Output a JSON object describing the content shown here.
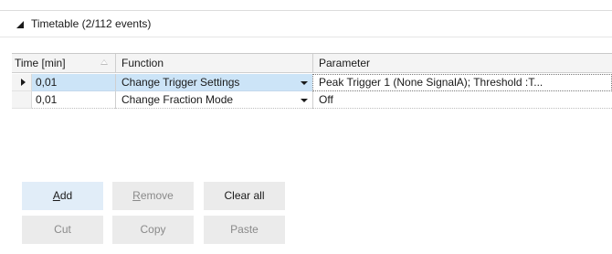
{
  "section": {
    "title": "Timetable (2/112 events)",
    "expanded": true
  },
  "table": {
    "columns": [
      "Time [min]",
      "Function",
      "Parameter"
    ],
    "sort_column": "Time [min]",
    "rows": [
      {
        "time": "0,01",
        "function": "Change Trigger Settings",
        "parameter": "Peak Trigger 1 (None SignalA); Threshold :T...",
        "current": true,
        "selected": true
      },
      {
        "time": "0,01",
        "function": "Change Fraction Mode",
        "parameter": "Off",
        "current": false,
        "selected": false
      }
    ]
  },
  "buttons": {
    "add": {
      "mnemonic": "A",
      "rest": "dd",
      "enabled": true
    },
    "remove": {
      "mnemonic": "R",
      "rest": "emove",
      "enabled": false
    },
    "clear_all": {
      "label": "Clear all",
      "enabled": true
    },
    "cut": {
      "label": "Cut",
      "enabled": false
    },
    "copy": {
      "label": "Copy",
      "enabled": false
    },
    "paste": {
      "label": "Paste",
      "enabled": false
    }
  },
  "colors": {
    "selection": "#cce4f7",
    "add_button_bg": "#e1edf8",
    "button_bg": "#ebebeb",
    "disabled_text": "#8a8a8a"
  }
}
